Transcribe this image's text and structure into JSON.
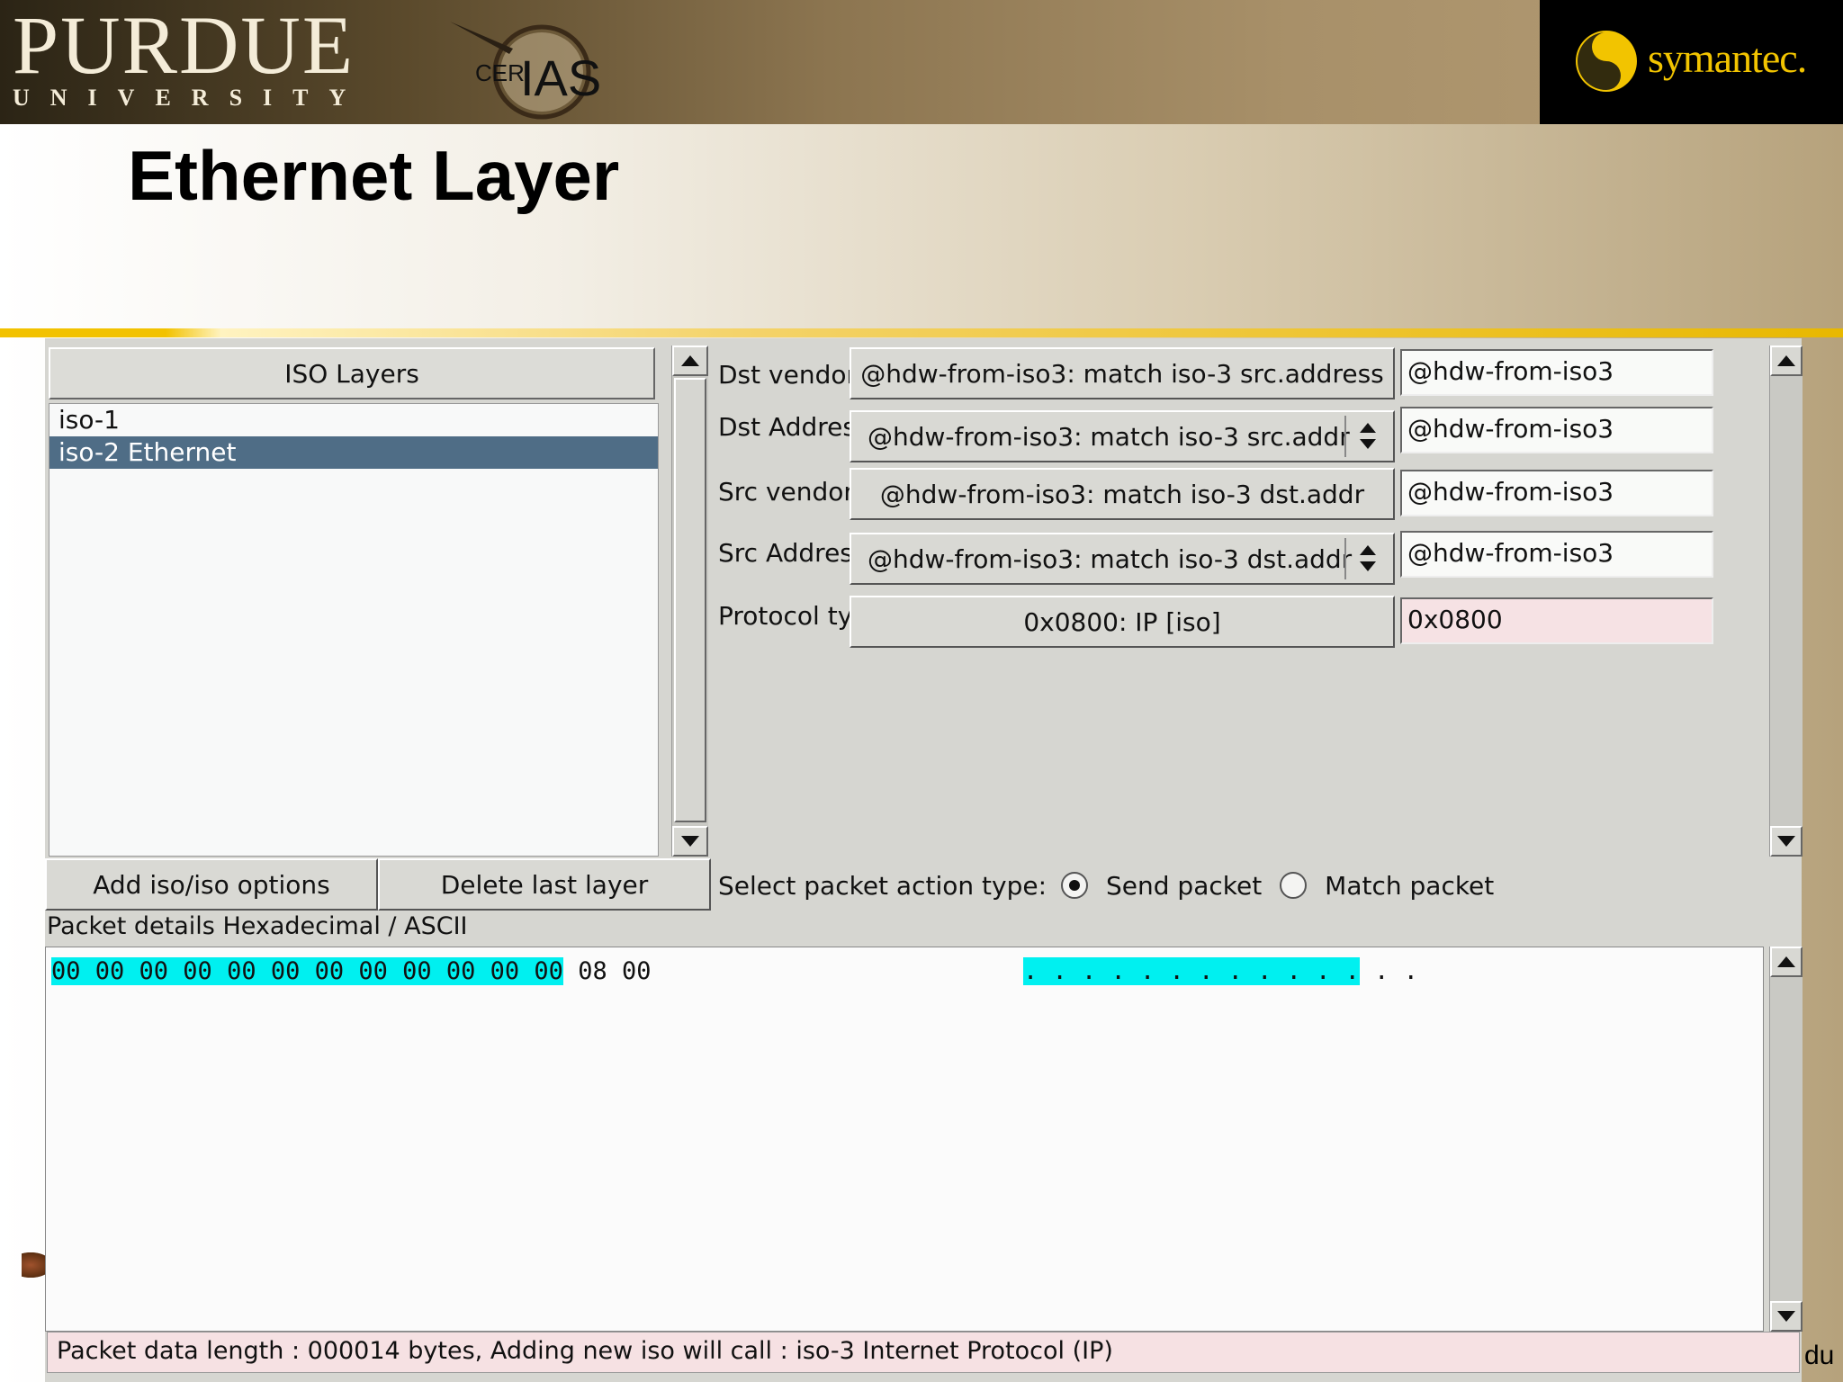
{
  "header": {
    "university": "PURDUE",
    "university_sub": "UNIVERSITY",
    "center_logo_text": "CERIAS",
    "sponsor": "symantec."
  },
  "slide_title": "Ethernet Layer",
  "left_panel": {
    "header": "ISO Layers",
    "items": [
      {
        "label": "iso-1",
        "selected": false
      },
      {
        "label": "iso-2 Ethernet",
        "selected": true
      }
    ]
  },
  "fields": [
    {
      "label": "Dst vendor",
      "button": "@hdw-from-iso3: match iso-3 src.address",
      "spin": false,
      "value": "@hdw-from-iso3"
    },
    {
      "label": "Dst Address",
      "button": "@hdw-from-iso3: match iso-3 src.addr",
      "spin": true,
      "value": "@hdw-from-iso3"
    },
    {
      "label": "Src vendor",
      "button": "@hdw-from-iso3: match iso-3 dst.addr",
      "spin": false,
      "value": "@hdw-from-iso3"
    },
    {
      "label": "Src Address",
      "button": "@hdw-from-iso3: match iso-3 dst.addr",
      "spin": true,
      "value": "@hdw-from-iso3"
    },
    {
      "label": "Protocol type",
      "button": "0x0800: IP [iso]",
      "spin": false,
      "value": "0x0800"
    }
  ],
  "buttons": {
    "add": "Add iso/iso options",
    "delete": "Delete last layer"
  },
  "action": {
    "label": "Select packet action type:",
    "options": [
      "Send packet",
      "Match packet"
    ],
    "selected": "Send packet"
  },
  "hex": {
    "label": "Packet details Hexadecimal / ASCII",
    "highlighted": "00 00 00 00 00 00 00 00 00 00 00 00",
    "rest": "08 00",
    "ascii_highlighted": ". . . . . . . . . . . .",
    "ascii_rest": " . ."
  },
  "status": "Packet data length : 000014 bytes, Adding new iso will call : iso-3 Internet Protocol (IP)",
  "edge_text": "du",
  "colors": {
    "selection": "#4f6d86",
    "hex_highlight": "#00f0f0",
    "pink_field": "#f6e2e4",
    "gold_rule": "#f2c200"
  }
}
